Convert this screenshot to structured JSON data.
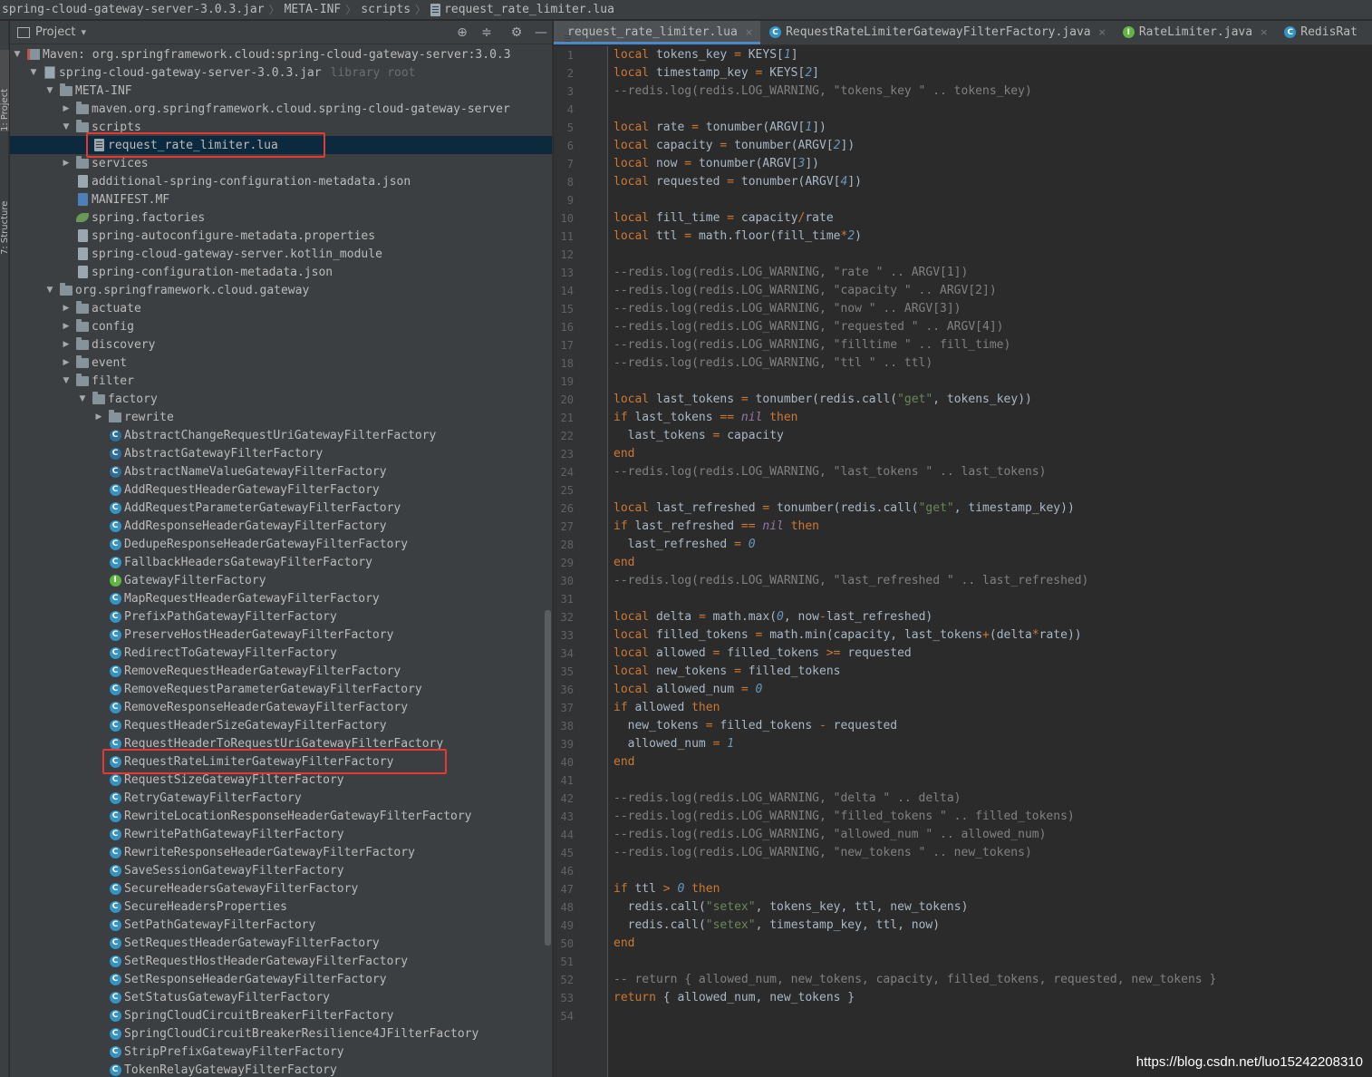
{
  "breadcrumbs": [
    "spring-cloud-gateway-server-3.0.3.jar",
    "META-INF",
    "scripts",
    "request_rate_limiter.lua"
  ],
  "tool_stripe": {
    "project": "1: Project",
    "structure": "7: Structure"
  },
  "project_panel": {
    "title": "Project",
    "dropdown": "▾",
    "icons": [
      "locate-icon",
      "collapse-icon",
      "gear-icon",
      "minimize-icon"
    ],
    "tree": [
      {
        "depth": 0,
        "expand": "open",
        "icon": "maven",
        "label": "Maven: org.springframework.cloud:spring-cloud-gateway-server:3.0.3"
      },
      {
        "depth": 1,
        "expand": "open",
        "icon": "jar",
        "label": "spring-cloud-gateway-server-3.0.3.jar",
        "extra": "library root"
      },
      {
        "depth": 2,
        "expand": "open",
        "icon": "folder",
        "label": "META-INF"
      },
      {
        "depth": 3,
        "expand": "closed",
        "icon": "folder",
        "label": "maven.org.springframework.cloud.spring-cloud-gateway-server"
      },
      {
        "depth": 3,
        "expand": "open",
        "icon": "folder",
        "label": "scripts"
      },
      {
        "depth": 4,
        "expand": "none",
        "icon": "lua",
        "label": "request_rate_limiter.lua",
        "selected": true
      },
      {
        "depth": 3,
        "expand": "closed",
        "icon": "folder",
        "label": "services"
      },
      {
        "depth": 3,
        "expand": "none",
        "icon": "json",
        "label": "additional-spring-configuration-metadata.json"
      },
      {
        "depth": 3,
        "expand": "none",
        "icon": "mf",
        "label": "MANIFEST.MF"
      },
      {
        "depth": 3,
        "expand": "none",
        "icon": "spring",
        "label": "spring.factories"
      },
      {
        "depth": 3,
        "expand": "none",
        "icon": "file",
        "label": "spring-autoconfigure-metadata.properties"
      },
      {
        "depth": 3,
        "expand": "none",
        "icon": "file",
        "label": "spring-cloud-gateway-server.kotlin_module"
      },
      {
        "depth": 3,
        "expand": "none",
        "icon": "file",
        "label": "spring-configuration-metadata.json"
      },
      {
        "depth": 2,
        "expand": "open",
        "icon": "folder",
        "label": "org.springframework.cloud.gateway"
      },
      {
        "depth": 3,
        "expand": "closed",
        "icon": "folder",
        "label": "actuate"
      },
      {
        "depth": 3,
        "expand": "closed",
        "icon": "folder",
        "label": "config"
      },
      {
        "depth": 3,
        "expand": "closed",
        "icon": "folder",
        "label": "discovery"
      },
      {
        "depth": 3,
        "expand": "closed",
        "icon": "folder",
        "label": "event"
      },
      {
        "depth": 3,
        "expand": "open",
        "icon": "folder",
        "label": "filter"
      },
      {
        "depth": 4,
        "expand": "open",
        "icon": "folder",
        "label": "factory"
      },
      {
        "depth": 5,
        "expand": "closed",
        "icon": "folder",
        "label": "rewrite"
      },
      {
        "depth": 5,
        "expand": "none",
        "icon": "abstract",
        "label": "AbstractChangeRequestUriGatewayFilterFactory"
      },
      {
        "depth": 5,
        "expand": "none",
        "icon": "abstract",
        "label": "AbstractGatewayFilterFactory"
      },
      {
        "depth": 5,
        "expand": "none",
        "icon": "abstract",
        "label": "AbstractNameValueGatewayFilterFactory"
      },
      {
        "depth": 5,
        "expand": "none",
        "icon": "class",
        "label": "AddRequestHeaderGatewayFilterFactory"
      },
      {
        "depth": 5,
        "expand": "none",
        "icon": "class",
        "label": "AddRequestParameterGatewayFilterFactory"
      },
      {
        "depth": 5,
        "expand": "none",
        "icon": "class",
        "label": "AddResponseHeaderGatewayFilterFactory"
      },
      {
        "depth": 5,
        "expand": "none",
        "icon": "class",
        "label": "DedupeResponseHeaderGatewayFilterFactory"
      },
      {
        "depth": 5,
        "expand": "none",
        "icon": "class",
        "label": "FallbackHeadersGatewayFilterFactory"
      },
      {
        "depth": 5,
        "expand": "none",
        "icon": "interface",
        "label": "GatewayFilterFactory"
      },
      {
        "depth": 5,
        "expand": "none",
        "icon": "class",
        "label": "MapRequestHeaderGatewayFilterFactory"
      },
      {
        "depth": 5,
        "expand": "none",
        "icon": "class",
        "label": "PrefixPathGatewayFilterFactory"
      },
      {
        "depth": 5,
        "expand": "none",
        "icon": "class",
        "label": "PreserveHostHeaderGatewayFilterFactory"
      },
      {
        "depth": 5,
        "expand": "none",
        "icon": "class",
        "label": "RedirectToGatewayFilterFactory"
      },
      {
        "depth": 5,
        "expand": "none",
        "icon": "class",
        "label": "RemoveRequestHeaderGatewayFilterFactory"
      },
      {
        "depth": 5,
        "expand": "none",
        "icon": "class",
        "label": "RemoveRequestParameterGatewayFilterFactory"
      },
      {
        "depth": 5,
        "expand": "none",
        "icon": "class",
        "label": "RemoveResponseHeaderGatewayFilterFactory"
      },
      {
        "depth": 5,
        "expand": "none",
        "icon": "class",
        "label": "RequestHeaderSizeGatewayFilterFactory"
      },
      {
        "depth": 5,
        "expand": "none",
        "icon": "class",
        "label": "RequestHeaderToRequestUriGatewayFilterFactory"
      },
      {
        "depth": 5,
        "expand": "none",
        "icon": "class",
        "label": "RequestRateLimiterGatewayFilterFactory",
        "highlight": true
      },
      {
        "depth": 5,
        "expand": "none",
        "icon": "class",
        "label": "RequestSizeGatewayFilterFactory"
      },
      {
        "depth": 5,
        "expand": "none",
        "icon": "class",
        "label": "RetryGatewayFilterFactory"
      },
      {
        "depth": 5,
        "expand": "none",
        "icon": "class",
        "label": "RewriteLocationResponseHeaderGatewayFilterFactory"
      },
      {
        "depth": 5,
        "expand": "none",
        "icon": "class",
        "label": "RewritePathGatewayFilterFactory"
      },
      {
        "depth": 5,
        "expand": "none",
        "icon": "class",
        "label": "RewriteResponseHeaderGatewayFilterFactory"
      },
      {
        "depth": 5,
        "expand": "none",
        "icon": "class",
        "label": "SaveSessionGatewayFilterFactory"
      },
      {
        "depth": 5,
        "expand": "none",
        "icon": "class",
        "label": "SecureHeadersGatewayFilterFactory"
      },
      {
        "depth": 5,
        "expand": "none",
        "icon": "class",
        "label": "SecureHeadersProperties"
      },
      {
        "depth": 5,
        "expand": "none",
        "icon": "class",
        "label": "SetPathGatewayFilterFactory"
      },
      {
        "depth": 5,
        "expand": "none",
        "icon": "class",
        "label": "SetRequestHeaderGatewayFilterFactory"
      },
      {
        "depth": 5,
        "expand": "none",
        "icon": "class",
        "label": "SetRequestHostHeaderGatewayFilterFactory"
      },
      {
        "depth": 5,
        "expand": "none",
        "icon": "class",
        "label": "SetResponseHeaderGatewayFilterFactory"
      },
      {
        "depth": 5,
        "expand": "none",
        "icon": "class",
        "label": "SetStatusGatewayFilterFactory"
      },
      {
        "depth": 5,
        "expand": "none",
        "icon": "class",
        "label": "SpringCloudCircuitBreakerFilterFactory"
      },
      {
        "depth": 5,
        "expand": "none",
        "icon": "class",
        "label": "SpringCloudCircuitBreakerResilience4JFilterFactory"
      },
      {
        "depth": 5,
        "expand": "none",
        "icon": "class",
        "label": "StripPrefixGatewayFilterFactory"
      },
      {
        "depth": 5,
        "expand": "none",
        "icon": "class",
        "label": "TokenRelayGatewayFilterFactory"
      }
    ]
  },
  "editor": {
    "tabs": [
      {
        "label": "request_rate_limiter.lua",
        "icon": "lua",
        "active": true,
        "close": "×"
      },
      {
        "label": "RequestRateLimiterGatewayFilterFactory.java",
        "icon": "class",
        "active": false,
        "close": "×"
      },
      {
        "label": "RateLimiter.java",
        "icon": "interface",
        "active": false,
        "close": "×"
      },
      {
        "label": "RedisRat",
        "icon": "class",
        "active": false,
        "close": ""
      }
    ],
    "lines": [
      "local tokens_key = KEYS[1]",
      "local timestamp_key = KEYS[2]",
      "--redis.log(redis.LOG_WARNING, \"tokens_key \" .. tokens_key)",
      "",
      "local rate = tonumber(ARGV[1])",
      "local capacity = tonumber(ARGV[2])",
      "local now = tonumber(ARGV[3])",
      "local requested = tonumber(ARGV[4])",
      "",
      "local fill_time = capacity/rate",
      "local ttl = math.floor(fill_time*2)",
      "",
      "--redis.log(redis.LOG_WARNING, \"rate \" .. ARGV[1])",
      "--redis.log(redis.LOG_WARNING, \"capacity \" .. ARGV[2])",
      "--redis.log(redis.LOG_WARNING, \"now \" .. ARGV[3])",
      "--redis.log(redis.LOG_WARNING, \"requested \" .. ARGV[4])",
      "--redis.log(redis.LOG_WARNING, \"filltime \" .. fill_time)",
      "--redis.log(redis.LOG_WARNING, \"ttl \" .. ttl)",
      "",
      "local last_tokens = tonumber(redis.call(\"get\", tokens_key))",
      "if last_tokens == nil then",
      "  last_tokens = capacity",
      "end",
      "--redis.log(redis.LOG_WARNING, \"last_tokens \" .. last_tokens)",
      "",
      "local last_refreshed = tonumber(redis.call(\"get\", timestamp_key))",
      "if last_refreshed == nil then",
      "  last_refreshed = 0",
      "end",
      "--redis.log(redis.LOG_WARNING, \"last_refreshed \" .. last_refreshed)",
      "",
      "local delta = math.max(0, now-last_refreshed)",
      "local filled_tokens = math.min(capacity, last_tokens+(delta*rate))",
      "local allowed = filled_tokens >= requested",
      "local new_tokens = filled_tokens",
      "local allowed_num = 0",
      "if allowed then",
      "  new_tokens = filled_tokens - requested",
      "  allowed_num = 1",
      "end",
      "",
      "--redis.log(redis.LOG_WARNING, \"delta \" .. delta)",
      "--redis.log(redis.LOG_WARNING, \"filled_tokens \" .. filled_tokens)",
      "--redis.log(redis.LOG_WARNING, \"allowed_num \" .. allowed_num)",
      "--redis.log(redis.LOG_WARNING, \"new_tokens \" .. new_tokens)",
      "",
      "if ttl > 0 then",
      "  redis.call(\"setex\", tokens_key, ttl, new_tokens)",
      "  redis.call(\"setex\", timestamp_key, ttl, now)",
      "end",
      "",
      "-- return { allowed_num, new_tokens, capacity, filled_tokens, requested, new_tokens }",
      "return { allowed_num, new_tokens }",
      ""
    ]
  },
  "watermark": "https://blog.csdn.net/luo15242208310",
  "colors": {
    "keyword": "#cc7832",
    "string": "#6a8759",
    "number": "#6897bb",
    "comment": "#808080",
    "nil": "#9876aa",
    "highlight": "#e53935"
  }
}
